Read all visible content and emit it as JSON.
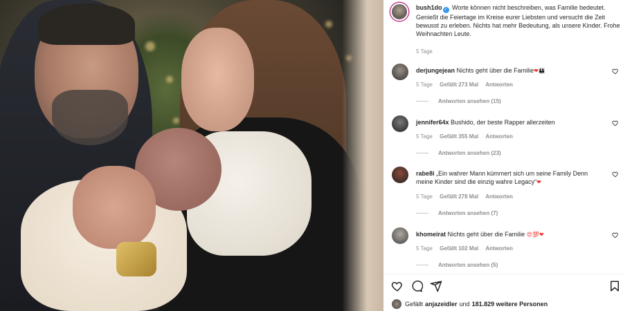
{
  "post": {
    "author": "bush1do",
    "caption": "Worte können nicht beschreiben, was Familie bedeutet. Genießt die Feiertage im Kreise eurer Liebsten und versucht die Zeit bewusst zu erleben. Nichts hat mehr Bedeutung, als unsere Kinder. Frohe Weihnachten Leute.",
    "time": "5 Tage"
  },
  "comments": [
    {
      "username": "derjungejean",
      "text": "Nichts geht über die Familie",
      "emoji": "❤👪",
      "time": "5 Tage",
      "likes": "Gefällt 273 Mal",
      "reply": "Antworten",
      "view_replies": "Antworten ansehen (15)"
    },
    {
      "username": "jennifer64x",
      "text": "Bushido, der beste Rapper allerzeiten",
      "emoji": "",
      "time": "5 Tage",
      "likes": "Gefällt 355 Mal",
      "reply": "Antworten",
      "view_replies": "Antworten ansehen (23)"
    },
    {
      "username": "rabe8i",
      "text": "„Ein wahrer Mann kümmert sich um seine Family Denn meine Kinder sind die einzig wahre Legacy“",
      "emoji": "❤",
      "time": "5 Tage",
      "likes": "Gefällt 278 Mal",
      "reply": "Antworten",
      "view_replies": "Antworten ansehen (7)"
    },
    {
      "username": "khomeirat",
      "text": "Nichts geht über die Familie",
      "emoji": "😍💯❤",
      "time": "5 Tage",
      "likes": "Gefällt 102 Mal",
      "reply": "Antworten",
      "view_replies": "Antworten ansehen (5)"
    }
  ],
  "likes_bar": {
    "prefix": "Gefällt",
    "user": "anjazeidler",
    "middle": "und",
    "count": "181.829 weitere Personen"
  },
  "icons": [
    "heart-icon",
    "comment-icon",
    "share-icon",
    "bookmark-icon",
    "verified-badge-icon"
  ],
  "colors": {
    "accent": "#3897f0",
    "muted": "#8e8e8e",
    "text": "#262626"
  }
}
